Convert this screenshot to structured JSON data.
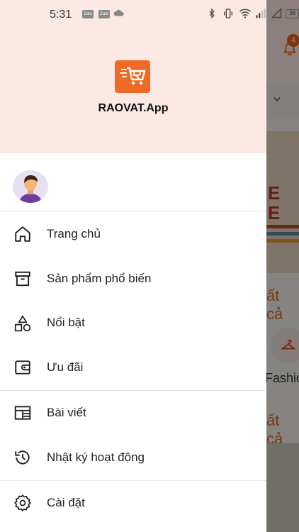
{
  "status_bar": {
    "time": "5:31",
    "zalo_icons": [
      "Zalo",
      "Zalo"
    ],
    "battery": "38"
  },
  "background": {
    "notification_count": "4",
    "section_text_1": "ất cả",
    "category_label": "Fashio",
    "section_text_2": "ất cả",
    "banner_letters": "E\nE"
  },
  "drawer": {
    "app_name": "RAOVAT.App",
    "accent_color": "#ef6a24",
    "menu": [
      {
        "label": "Trang chủ",
        "icon": "home-icon"
      },
      {
        "label": "Sản phẩm phổ biến",
        "icon": "archive-box-icon"
      },
      {
        "label": "Nổi bật",
        "icon": "shapes-icon"
      },
      {
        "label": "Ưu đãi",
        "icon": "wallet-icon"
      },
      {
        "label": "Bài viết",
        "icon": "article-icon"
      },
      {
        "label": "Nhật ký hoạt động",
        "icon": "history-icon"
      },
      {
        "label": "Cài đặt",
        "icon": "gear-icon"
      }
    ]
  }
}
